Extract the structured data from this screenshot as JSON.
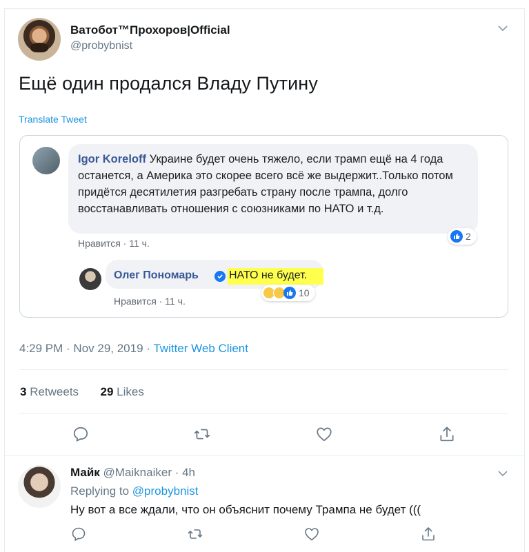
{
  "tweet": {
    "author_name": "Ватобот™Прохоров|Official",
    "author_handle": "@probybnist",
    "text": "Ещё один продался Владу Путину",
    "translate_label": "Translate Tweet",
    "timestamp": "4:29 PM · Nov 29, 2019 · ",
    "client": "Twitter Web Client",
    "stats": {
      "retweets_count": "3",
      "retweets_label": " Retweets",
      "likes_count": "29",
      "likes_label": " Likes"
    }
  },
  "embedded_image": {
    "comment1": {
      "author": "Igor Koreloff",
      "text": " Украине будет очень тяжело, если трамп ещё на 4 года останется, а Америка это скорее всего всё же выдержит..Только потом придётся десятилетия разгребать страну после трампа, долго восстанавливать отношения с союзниками по НАТО и т.д.",
      "like_label": "Нравится",
      "time": " · 11 ч.",
      "reactions_count": "2"
    },
    "comment2": {
      "author": "Олег Пономарь",
      "text": "НАТО не будет.",
      "like_label": "Нравится",
      "time": " · 11 ч.",
      "reactions_count": "10"
    }
  },
  "reply": {
    "author_name": "Майк",
    "author_handle": "@Maiknaiker",
    "time": " · 4h",
    "replying_prefix": "Replying to ",
    "replying_mention": "@probybnist",
    "text": "Ну вот а все ждали, что он объяснит почему Трампа не будет ((("
  },
  "colors": {
    "accent": "#1b95e0",
    "secondary_text": "#657786",
    "highlight": "#ffff4d"
  },
  "icons": [
    "chevron-down-icon",
    "reply-icon",
    "retweet-icon",
    "like-icon",
    "share-icon",
    "verified-icon",
    "fb-like-icon"
  ]
}
